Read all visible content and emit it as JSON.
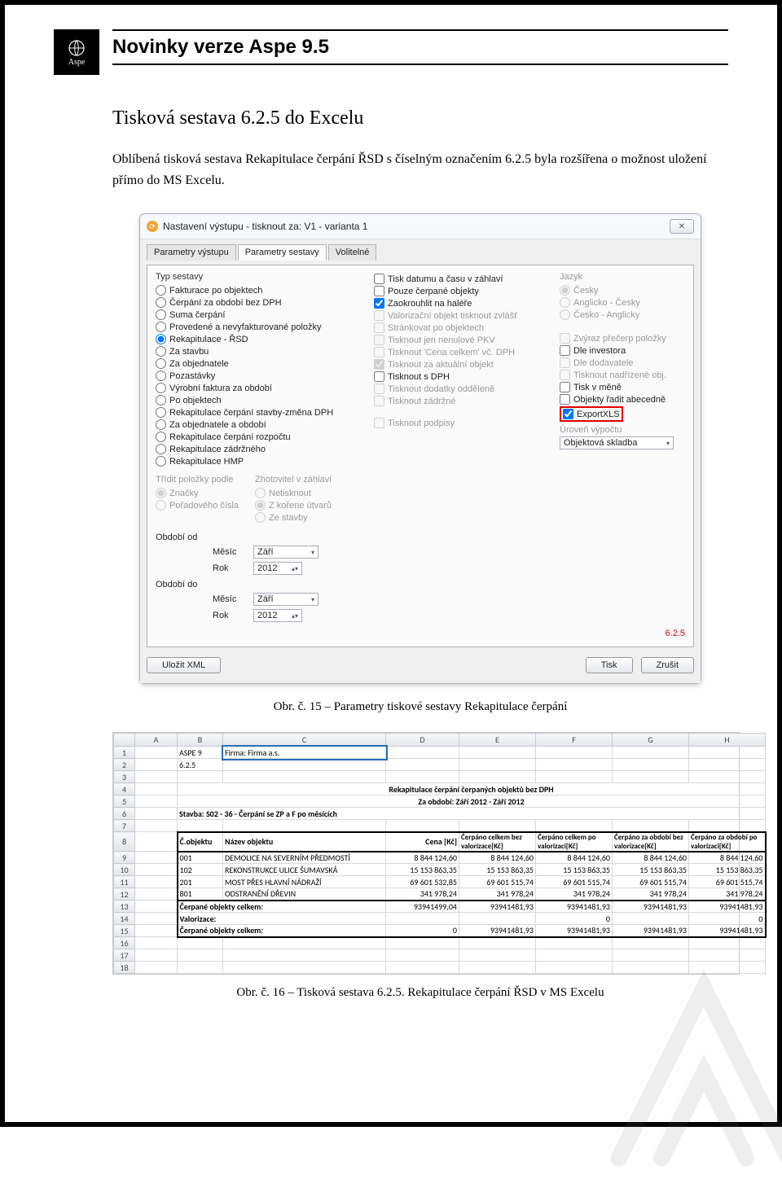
{
  "header": {
    "page_title": "Novinky verze Aspe 9.5",
    "logo_text": "Aspe"
  },
  "section": {
    "title": "Tisková sestava 6.2.5 do Excelu",
    "body": "Oblíbená tisková sestava Rekapitulace čerpání ŘSD s číselným označením 6.2.5 byla rozšířena o možnost uložení přímo do MS Excelu."
  },
  "dialog": {
    "title": "Nastavení výstupu - tisknout za: V1 - varianta 1",
    "close": "✕",
    "tabs": [
      "Parametry výstupu",
      "Parametry sestavy",
      "Volitelné"
    ],
    "active_tab": 1,
    "typ_label": "Typ sestavy",
    "radios": [
      "Fakturace po objektech",
      "Čerpání za období bez DPH",
      "Suma čerpání",
      "Provedené a nevyfakturované položky",
      "Rekapitulace - ŘSD",
      "Za stavbu",
      "Za objednatele",
      "Pozastávky",
      "Výrobní faktura za období",
      "Po objektech",
      "Rekapitulace čerpání stavby-změna DPH",
      "Za objednatele a období",
      "Rekapitulace čerpání rozpočtu",
      "Rekapitulace zádržného",
      "Rekapitulace HMP"
    ],
    "radio_selected": 4,
    "checks_col2": [
      {
        "label": "Tisk datumu a času v záhlaví",
        "checked": false,
        "disabled": false
      },
      {
        "label": "Pouze čerpané objekty",
        "checked": false,
        "disabled": false
      },
      {
        "label": "Zaokrouhlit na haléře",
        "checked": true,
        "disabled": false
      },
      {
        "label": "Valorizační objekt tisknout zvlášť",
        "checked": false,
        "disabled": true
      },
      {
        "label": "Stránkovat po objektech",
        "checked": false,
        "disabled": true
      },
      {
        "label": "Tisknout jen nenulové PKV",
        "checked": false,
        "disabled": true
      },
      {
        "label": "Tisknout 'Cena celkem' vč. DPH",
        "checked": false,
        "disabled": true
      },
      {
        "label": "Tisknout za aktuální objekt",
        "checked": true,
        "disabled": true
      },
      {
        "label": "Tisknout s DPH",
        "checked": false,
        "disabled": false
      },
      {
        "label": "Tisknout dodatky odděleně",
        "checked": false,
        "disabled": true
      },
      {
        "label": "Tisknout zádržné",
        "checked": false,
        "disabled": true
      },
      {
        "label": "Tisknout podpisy",
        "checked": false,
        "disabled": true
      }
    ],
    "jazyk_label": "Jazyk",
    "jazyk_radios": [
      {
        "label": "Česky",
        "disabled": true,
        "selected": true
      },
      {
        "label": "Anglicko - Česky",
        "disabled": true,
        "selected": false
      },
      {
        "label": "Česko - Anglicky",
        "disabled": true,
        "selected": false
      }
    ],
    "checks_col3": [
      {
        "label": "Zvýraz přečerp položky",
        "checked": false,
        "disabled": true
      },
      {
        "label": "Dle investora",
        "checked": false,
        "disabled": false
      },
      {
        "label": "Dle dodavatele",
        "checked": false,
        "disabled": true
      },
      {
        "label": "Tisknout nadřízené obj.",
        "checked": false,
        "disabled": true
      },
      {
        "label": "Tisk v měně",
        "checked": false,
        "disabled": false
      },
      {
        "label": "Objekty řadit abecedně",
        "checked": false,
        "disabled": false
      },
      {
        "label": "ExportXLS",
        "checked": true,
        "disabled": false,
        "highlight": true
      }
    ],
    "uroven_label": "Úroveň výpočtu",
    "uroven_value": "Objektová skladba",
    "sort_label": "Třídit položky podle",
    "sort_radios": [
      {
        "label": "Značky",
        "selected": true,
        "disabled": true
      },
      {
        "label": "Pořadového čísla",
        "selected": false,
        "disabled": true
      }
    ],
    "zhot_label": "Zhotovitel v záhlaví",
    "zhot_radios": [
      {
        "label": "Netisknout",
        "selected": false,
        "disabled": true
      },
      {
        "label": "Z kořene útvarů",
        "selected": true,
        "disabled": true
      },
      {
        "label": "Ze stavby",
        "selected": false,
        "disabled": true
      }
    ],
    "obdobi_od": "Období od",
    "obdobi_do": "Období do",
    "mesic_label": "Měsíc",
    "rok_label": "Rok",
    "mesic_value": "Září",
    "rok_value": "2012",
    "version": "6.2.5",
    "btn_xml": "Uložit XML",
    "btn_tisk": "Tisk",
    "btn_zrusit": "Zrušit"
  },
  "caption1": "Obr. č. 15 – Parametry tiskové sestavy Rekapitulace čerpání",
  "excel": {
    "cols": [
      "",
      "A",
      "B",
      "C",
      "D",
      "E",
      "F",
      "G",
      "H"
    ],
    "row1": {
      "a": "ASPE 9",
      "c": "Firma: Firma a.s."
    },
    "row2": {
      "a": "6.2.5"
    },
    "title1": "Rekapitulace čerpání čerpaných objektů bez DPH",
    "title2": "Za období: Září 2012 - Září 2012",
    "stavba": "Stavba: S02 - 36 - Čerpání se ZP a F po měsících",
    "head": [
      "Č.objektu",
      "Název objektu",
      "Cena [Kč]",
      "Čerpáno celkem bez valorizace[Kč]",
      "Čerpáno celkem po valorizaci[Kč]",
      "Čerpáno za období bez valorizace[Kč]",
      "Čerpáno za období po valorizaci[Kč]"
    ],
    "rows": [
      [
        "001",
        "DEMOLICE NA SEVERNÍM PŘEDMOSTÍ",
        "8 844 124,60",
        "8 844 124,60",
        "8 844 124,60",
        "8 844 124,60",
        "8 844 124,60"
      ],
      [
        "102",
        "REKONSTRUKCE ULICE ŠUMAVSKÁ",
        "15 153 863,35",
        "15 153 863,35",
        "15 153 863,35",
        "15 153 863,35",
        "15 153 863,35"
      ],
      [
        "201",
        "MOST PŘES HLAVNÍ NÁDRAŽÍ",
        "69 601 532,85",
        "69 601 515,74",
        "69 601 515,74",
        "69 601 515,74",
        "69 601 515,74"
      ],
      [
        "801",
        "ODSTRANĚNÍ DŘEVIN",
        "341 978,24",
        "341 978,24",
        "341 978,24",
        "341 978,24",
        "341 978,24"
      ]
    ],
    "sum1_label": "Čerpané objekty celkem:",
    "sum1": [
      "93941499,04",
      "93941481,93",
      "93941481,93",
      "93941481,93",
      "93941481,93"
    ],
    "valor_label": "Valorizace:",
    "valor": [
      "",
      "",
      "0",
      "",
      "0"
    ],
    "sum2_label": "Čerpané objekty celkem:",
    "sum2": [
      "0",
      "93941481,93",
      "93941481,93",
      "93941481,93",
      "93941481,93"
    ]
  },
  "caption2": "Obr. č. 16 – Tisková sestava 6.2.5. Rekapitulace čerpání ŘSD v MS Excelu"
}
